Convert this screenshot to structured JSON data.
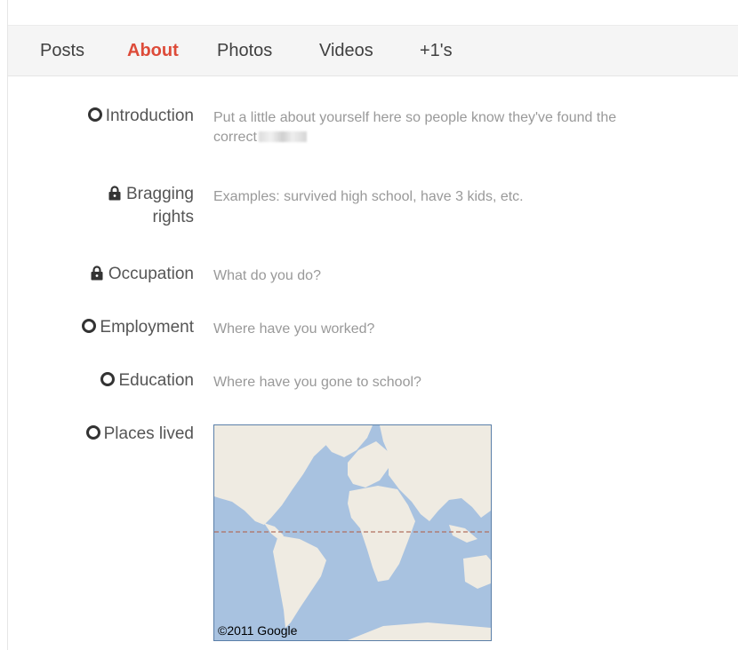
{
  "tabs": [
    {
      "label": "Posts",
      "active": false
    },
    {
      "label": "About",
      "active": true
    },
    {
      "label": "Photos",
      "active": false
    },
    {
      "label": "Videos",
      "active": false
    },
    {
      "label": "+1's",
      "active": false
    }
  ],
  "colors": {
    "active_tab": "#dd4b39",
    "label": "#555555",
    "placeholder": "#999999"
  },
  "fields": {
    "introduction": {
      "label": "Introduction",
      "icon": "circle-icon",
      "placeholder": "Put a little about yourself here so people know they've found the",
      "placeholder_cont": "correct"
    },
    "bragging_rights": {
      "label_line1": "Bragging",
      "label_line2": "rights",
      "icon": "lock-icon",
      "placeholder": "Examples: survived high school, have 3 kids, etc."
    },
    "occupation": {
      "label": "Occupation",
      "icon": "lock-icon",
      "placeholder": "What do you do?"
    },
    "employment": {
      "label": "Employment",
      "icon": "circle-icon",
      "placeholder": "Where have you worked?"
    },
    "education": {
      "label": "Education",
      "icon": "circle-icon",
      "placeholder": "Where have you gone to school?"
    },
    "places_lived": {
      "label": "Places lived",
      "icon": "circle-icon"
    }
  },
  "map": {
    "copyright": "©2011 Google"
  }
}
